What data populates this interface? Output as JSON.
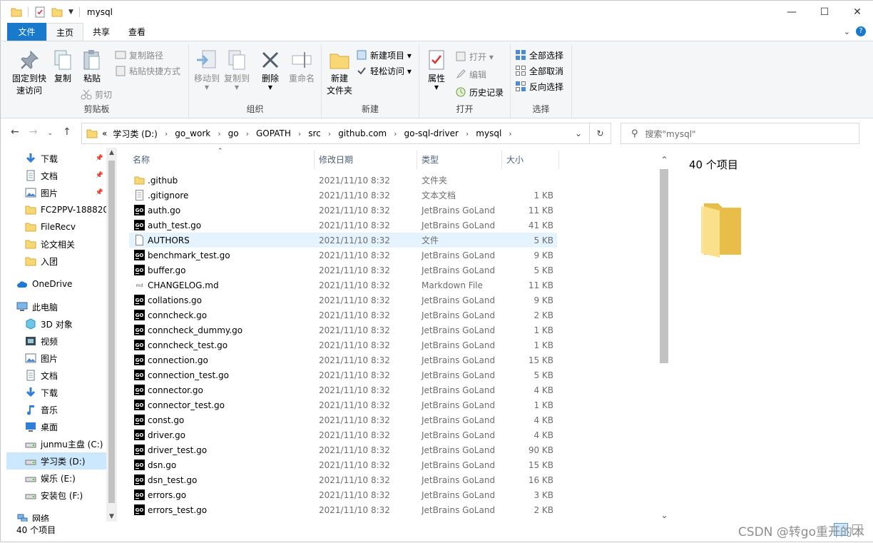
{
  "window": {
    "title": "mysql",
    "controls": {
      "minimize": "—",
      "maximize": "☐",
      "close": "✕"
    }
  },
  "ribbon_tabs": [
    "文件",
    "主页",
    "共享",
    "查看"
  ],
  "ribbon": {
    "clipboard": {
      "pin": "固定到快\n速访问",
      "copy": "复制",
      "paste": "粘贴",
      "copy_path": "复制路径",
      "paste_shortcut": "粘贴快捷方式",
      "cut": "剪切",
      "label": "剪贴板"
    },
    "organize": {
      "move_to": "移动到",
      "copy_to": "复制到",
      "delete": "删除",
      "rename": "重命名",
      "label": "组织"
    },
    "new": {
      "new_folder": "新建\n文件夹",
      "new_item": "新建项目 ▾",
      "easy_access": "轻松访问 ▾",
      "label": "新建"
    },
    "open": {
      "properties": "属性",
      "open": "打开 ▾",
      "edit": "编辑",
      "history": "历史记录",
      "label": "打开"
    },
    "select": {
      "select_all": "全部选择",
      "select_none": "全部取消",
      "invert": "反向选择",
      "label": "选择"
    }
  },
  "address": {
    "breadcrumbs": [
      "«",
      "学习类 (D:)",
      "go_work",
      "go",
      "GOPATH",
      "src",
      "github.com",
      "go-sql-driver",
      "mysql"
    ],
    "search_placeholder": "搜索\"mysql\""
  },
  "nav": {
    "items": [
      {
        "label": "下载",
        "icon": "download-icon",
        "pinned": true
      },
      {
        "label": "文档",
        "icon": "document-icon",
        "pinned": true
      },
      {
        "label": "图片",
        "icon": "picture-icon",
        "pinned": true
      },
      {
        "label": "FC2PPV-188820",
        "icon": "folder-icon",
        "pinned": false
      },
      {
        "label": "FileRecv",
        "icon": "folder-icon",
        "pinned": false
      },
      {
        "label": "论文相关",
        "icon": "folder-icon",
        "pinned": false
      },
      {
        "label": "入团",
        "icon": "folder-icon",
        "pinned": false
      },
      {
        "label": "OneDrive",
        "icon": "cloud-icon",
        "pinned": false
      },
      {
        "label": "此电脑",
        "icon": "computer-icon",
        "pinned": false
      },
      {
        "label": "3D 对象",
        "icon": "cube-icon",
        "pinned": false
      },
      {
        "label": "视频",
        "icon": "video-icon",
        "pinned": false
      },
      {
        "label": "图片",
        "icon": "picture-icon",
        "pinned": false
      },
      {
        "label": "文档",
        "icon": "document-icon",
        "pinned": false
      },
      {
        "label": "下载",
        "icon": "download-icon",
        "pinned": false
      },
      {
        "label": "音乐",
        "icon": "music-icon",
        "pinned": false
      },
      {
        "label": "桌面",
        "icon": "desktop-icon",
        "pinned": false
      },
      {
        "label": "junmu主盘 (C:)",
        "icon": "drive-icon",
        "pinned": false
      },
      {
        "label": "学习类 (D:)",
        "icon": "drive-icon",
        "pinned": false,
        "selected": true
      },
      {
        "label": "娱乐 (E:)",
        "icon": "drive-icon",
        "pinned": false
      },
      {
        "label": "安装包 (F:)",
        "icon": "drive-icon",
        "pinned": false
      },
      {
        "label": "网络",
        "icon": "network-icon",
        "pinned": false
      }
    ]
  },
  "columns": {
    "name": "名称",
    "date": "修改日期",
    "type": "类型",
    "size": "大小"
  },
  "files": [
    {
      "name": ".github",
      "date": "2021/11/10 8:32",
      "type": "文件夹",
      "size": "",
      "icon": "folder"
    },
    {
      "name": ".gitignore",
      "date": "2021/11/10 8:32",
      "type": "文本文档",
      "size": "1 KB",
      "icon": "text"
    },
    {
      "name": "auth.go",
      "date": "2021/11/10 8:32",
      "type": "JetBrains GoLand",
      "size": "11 KB",
      "icon": "go"
    },
    {
      "name": "auth_test.go",
      "date": "2021/11/10 8:32",
      "type": "JetBrains GoLand",
      "size": "41 KB",
      "icon": "go"
    },
    {
      "name": "AUTHORS",
      "date": "2021/11/10 8:32",
      "type": "文件",
      "size": "5 KB",
      "icon": "blank",
      "highlight": true
    },
    {
      "name": "benchmark_test.go",
      "date": "2021/11/10 8:32",
      "type": "JetBrains GoLand",
      "size": "9 KB",
      "icon": "go"
    },
    {
      "name": "buffer.go",
      "date": "2021/11/10 8:32",
      "type": "JetBrains GoLand",
      "size": "5 KB",
      "icon": "go"
    },
    {
      "name": "CHANGELOG.md",
      "date": "2021/11/10 8:32",
      "type": "Markdown File",
      "size": "11 KB",
      "icon": "md"
    },
    {
      "name": "collations.go",
      "date": "2021/11/10 8:32",
      "type": "JetBrains GoLand",
      "size": "9 KB",
      "icon": "go"
    },
    {
      "name": "conncheck.go",
      "date": "2021/11/10 8:32",
      "type": "JetBrains GoLand",
      "size": "2 KB",
      "icon": "go"
    },
    {
      "name": "conncheck_dummy.go",
      "date": "2021/11/10 8:32",
      "type": "JetBrains GoLand",
      "size": "1 KB",
      "icon": "go"
    },
    {
      "name": "conncheck_test.go",
      "date": "2021/11/10 8:32",
      "type": "JetBrains GoLand",
      "size": "1 KB",
      "icon": "go"
    },
    {
      "name": "connection.go",
      "date": "2021/11/10 8:32",
      "type": "JetBrains GoLand",
      "size": "15 KB",
      "icon": "go"
    },
    {
      "name": "connection_test.go",
      "date": "2021/11/10 8:32",
      "type": "JetBrains GoLand",
      "size": "5 KB",
      "icon": "go"
    },
    {
      "name": "connector.go",
      "date": "2021/11/10 8:32",
      "type": "JetBrains GoLand",
      "size": "4 KB",
      "icon": "go"
    },
    {
      "name": "connector_test.go",
      "date": "2021/11/10 8:32",
      "type": "JetBrains GoLand",
      "size": "1 KB",
      "icon": "go"
    },
    {
      "name": "const.go",
      "date": "2021/11/10 8:32",
      "type": "JetBrains GoLand",
      "size": "4 KB",
      "icon": "go"
    },
    {
      "name": "driver.go",
      "date": "2021/11/10 8:32",
      "type": "JetBrains GoLand",
      "size": "4 KB",
      "icon": "go"
    },
    {
      "name": "driver_test.go",
      "date": "2021/11/10 8:32",
      "type": "JetBrains GoLand",
      "size": "90 KB",
      "icon": "go"
    },
    {
      "name": "dsn.go",
      "date": "2021/11/10 8:32",
      "type": "JetBrains GoLand",
      "size": "15 KB",
      "icon": "go"
    },
    {
      "name": "dsn_test.go",
      "date": "2021/11/10 8:32",
      "type": "JetBrains GoLand",
      "size": "16 KB",
      "icon": "go"
    },
    {
      "name": "errors.go",
      "date": "2021/11/10 8:32",
      "type": "JetBrains GoLand",
      "size": "3 KB",
      "icon": "go"
    },
    {
      "name": "errors_test.go",
      "date": "2021/11/10 8:32",
      "type": "JetBrains GoLand",
      "size": "2 KB",
      "icon": "go"
    }
  ],
  "preview": {
    "count": "40 个项目"
  },
  "status": {
    "count": "40 个项目"
  },
  "watermark": "CSDN @转go重开的木"
}
